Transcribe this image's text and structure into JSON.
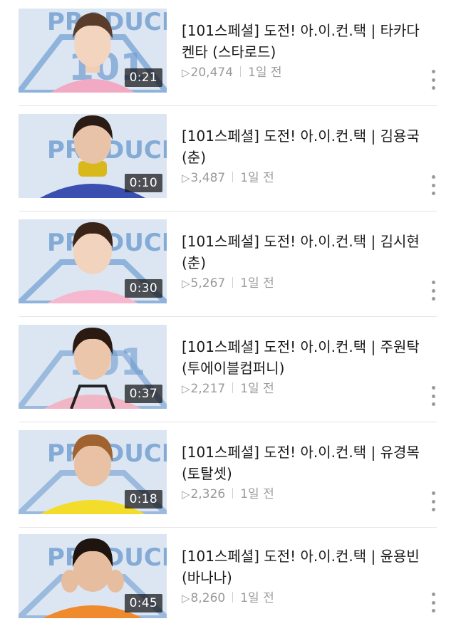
{
  "colors": {
    "thumb_bg": "#dbe6f2",
    "logo_blue": "#2f6fb8",
    "title_text": "#1a1a1a",
    "meta_text": "#9a9a9a"
  },
  "icons": {
    "play": "play-icon",
    "more": "more-vertical-icon"
  },
  "videos": [
    {
      "title_line1": "[101스페셜] 도전! 아.이.컨.택 | 타카다",
      "title_line2": "켄타 (스타로드)",
      "duration": "0:21",
      "views": "20,474",
      "age": "1일 전",
      "shirt_color": "#f2a9c4",
      "hair_color": "#5b3b2a"
    },
    {
      "title_line1": "[101스페셜] 도전! 아.이.컨.택 | 김용국",
      "title_line2": "(춘)",
      "duration": "0:10",
      "views": "3,487",
      "age": "1일 전",
      "shirt_color": "#3b4fb0",
      "hair_color": "#2a1c14"
    },
    {
      "title_line1": "[101스페셜] 도전! 아.이.컨.택 | 김시현",
      "title_line2": "(춘)",
      "duration": "0:30",
      "views": "5,267",
      "age": "1일 전",
      "shirt_color": "#f5b8cf",
      "hair_color": "#3a2418"
    },
    {
      "title_line1": "[101스페셜] 도전! 아.이.컨.택 | 주원탁",
      "title_line2": "(투에이블컴퍼니)",
      "duration": "0:37",
      "views": "2,217",
      "age": "1일 전",
      "shirt_color": "#f0b6c6",
      "hair_color": "#2a1a12"
    },
    {
      "title_line1": "[101스페셜] 도전! 아.이.컨.택 | 유경목",
      "title_line2": "(토탈셋)",
      "duration": "0:18",
      "views": "2,326",
      "age": "1일 전",
      "shirt_color": "#f3dc2a",
      "hair_color": "#a0622e"
    },
    {
      "title_line1": "[101스페셜] 도전! 아.이.컨.택 | 윤용빈",
      "title_line2": "(바나나)",
      "duration": "0:45",
      "views": "8,260",
      "age": "1일 전",
      "shirt_color": "#f08a2e",
      "hair_color": "#1e1410"
    }
  ]
}
